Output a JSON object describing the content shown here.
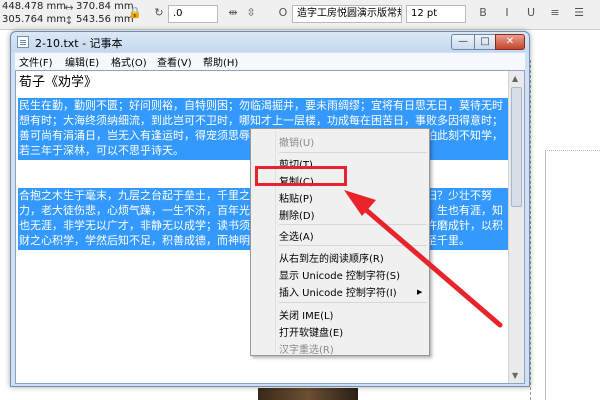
{
  "background_app": {
    "fields": {
      "x_pos": "448.478 mm",
      "y_pos": "305.764 mm",
      "width": "370.84 mm",
      "height": "543.56 mm",
      "rotation": ".0",
      "font_name": "造字工房悦圆演示版常规",
      "font_size": "12 pt"
    }
  },
  "window": {
    "title": "2-10.txt - 记事本",
    "buttons": {
      "minimize": "—",
      "maximize": "□",
      "close": "✕"
    }
  },
  "menubar": {
    "items": [
      "文件(F)",
      "编辑(E)",
      "格式(O)",
      "查看(V)",
      "帮助(H)"
    ]
  },
  "document": {
    "title": "荀子《劝学》",
    "paragraph_1": "民生在勤，勤则不匮；好问则裕，自特则困；勿临渴掘井，要未雨绸缪；宜将有日思无日，莫待无时想有时；大海终须纳细流，到此岂可不卫时，哪知才上一层楼，功成每在困苦日，事败多因得意时；善可尚有涓涌日，岂无入有逢运时，得宠须思辱，居安要思危。一年此时失所成，只怕此刻不知学，若三年于深林，可以不思乎诗天。",
    "paragraph_2": "合抱之木生于毫末，九层之台起于垒土，千里之行始于足下，百川东到海，何时复西归？少壮不努力，老大徒伤悲，心烦气躁，一生不济，百年光阴，似箭如梭，日月如梭，光阴似箭，生也有涯，知也无涯，非学无以广才，非静无以成学；读书须用意，一字值千金，只要功夫深，铁杵磨成针，以积财之心积学，学然后知不足，积善成德，而神明自得，圣心备焉，故不积跬步，无以至千里。"
  },
  "context_menu": {
    "items": [
      {
        "label": "撤销(U)",
        "enabled": false
      },
      {
        "label": "剪切(T)",
        "enabled": true
      },
      {
        "label": "复制(C)",
        "enabled": true
      },
      {
        "label": "粘贴(P)",
        "enabled": true
      },
      {
        "label": "删除(D)",
        "enabled": true
      },
      {
        "label": "全选(A)",
        "enabled": true
      },
      {
        "label": "从右到左的阅读顺序(R)",
        "enabled": true
      },
      {
        "label": "显示 Unicode 控制字符(S)",
        "enabled": true
      },
      {
        "label": "插入 Unicode 控制字符(I)",
        "enabled": true,
        "submenu": true
      },
      {
        "label": "关闭 IME(L)",
        "enabled": true
      },
      {
        "label": "打开软键盘(E)",
        "enabled": true
      },
      {
        "label": "汉字重选(R)",
        "enabled": false
      }
    ]
  },
  "colors": {
    "selection": "#3399ff",
    "annotation": "#e8232a"
  }
}
